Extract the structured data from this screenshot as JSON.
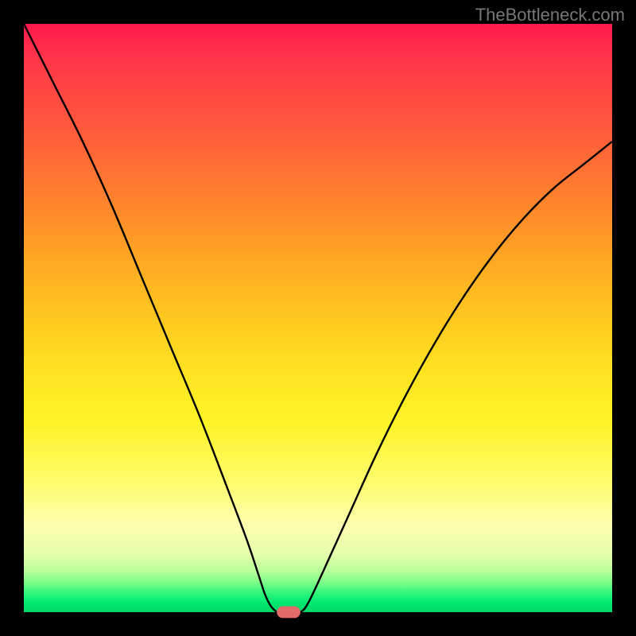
{
  "watermark": "TheBottleneck.com",
  "chart_data": {
    "type": "line",
    "title": "",
    "xlabel": "",
    "ylabel": "",
    "xlim": [
      0,
      100
    ],
    "ylim": [
      0,
      100
    ],
    "grid": false,
    "legend": false,
    "series": [
      {
        "name": "left-curve",
        "x": [
          0,
          5,
          10,
          15,
          20,
          25,
          30,
          35,
          38,
          40,
          41,
          42,
          43
        ],
        "y": [
          100,
          90,
          80,
          69,
          57,
          45,
          33,
          20,
          12,
          6,
          3,
          1,
          0
        ]
      },
      {
        "name": "right-curve",
        "x": [
          47,
          48,
          50,
          55,
          60,
          65,
          70,
          75,
          80,
          85,
          90,
          95,
          100
        ],
        "y": [
          0,
          1,
          5,
          16,
          27,
          37,
          46,
          54,
          61,
          67,
          72,
          76,
          80
        ]
      }
    ],
    "marker": {
      "name": "bottleneck-marker",
      "x": 45,
      "y": 0,
      "width": 4,
      "height": 2
    },
    "gradient_colors": {
      "top": "#ff1a4d",
      "mid_high": "#ff8a2a",
      "mid": "#ffe021",
      "mid_low": "#fffc6d",
      "low": "#00d769"
    }
  }
}
